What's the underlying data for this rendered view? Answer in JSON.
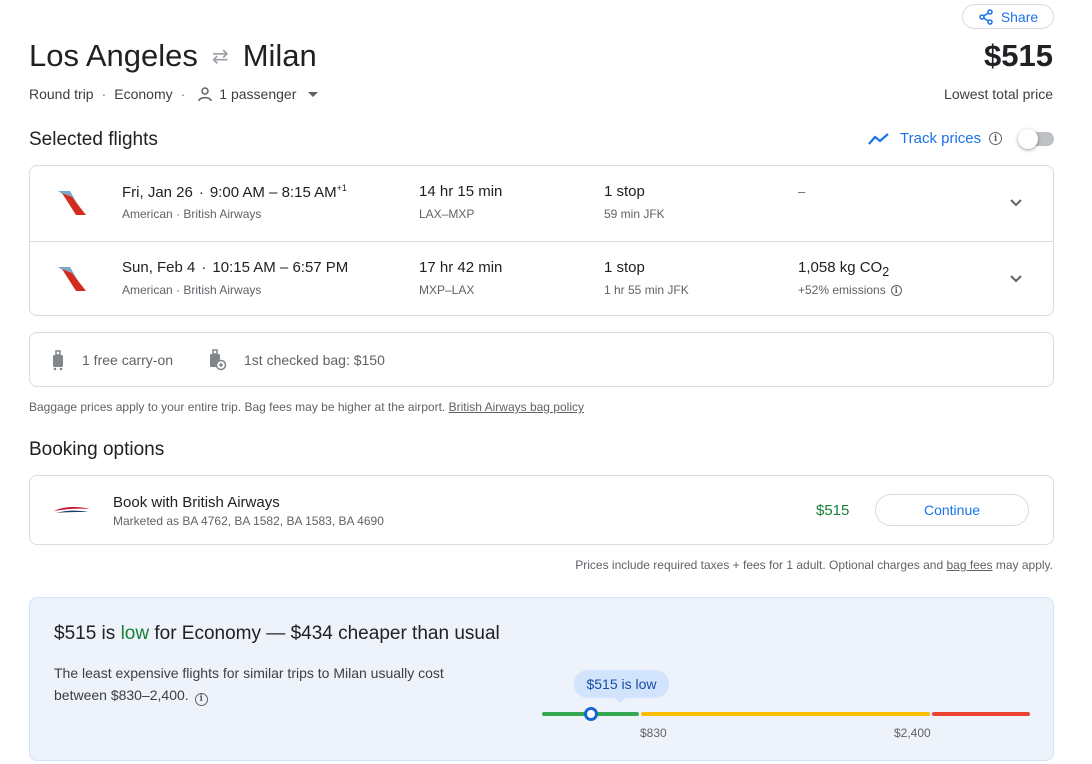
{
  "header": {
    "share_label": "Share",
    "origin": "Los Angeles",
    "destination": "Milan",
    "trip_type": "Round trip",
    "cabin": "Economy",
    "passengers": "1 passenger",
    "price": "$515",
    "price_caption": "Lowest total price"
  },
  "selected_flights": {
    "title": "Selected flights",
    "track_label": "Track prices",
    "flights": [
      {
        "date": "Fri, Jan 26",
        "times": "9:00 AM – 8:15 AM",
        "day_offset": "+1",
        "airlines": "American · British Airways",
        "duration": "14 hr 15 min",
        "route": "LAX–MXP",
        "stops": "1 stop",
        "layover": "59 min JFK",
        "emissions": "–",
        "emissions_note": ""
      },
      {
        "date": "Sun, Feb 4",
        "times": "10:15 AM – 6:57 PM",
        "day_offset": "",
        "airlines": "American · British Airways",
        "duration": "17 hr 42 min",
        "route": "MXP–LAX",
        "stops": "1 stop",
        "layover": "1 hr 55 min JFK",
        "emissions": "1,058 kg CO",
        "emissions_sub": "2",
        "emissions_note": "+52% emissions"
      }
    ]
  },
  "baggage": {
    "carry_on": "1 free carry-on",
    "checked": "1st checked bag: $150",
    "note": "Baggage prices apply to your entire trip. Bag fees may be higher at the airport.",
    "policy_link": "British Airways bag policy"
  },
  "booking": {
    "title": "Booking options",
    "provider": "Book with British Airways",
    "marketed": "Marketed as BA 4762, BA 1582, BA 1583, BA 4690",
    "price": "$515",
    "continue_label": "Continue",
    "note_before": "Prices include required taxes + fees for 1 adult. Optional charges and",
    "note_link": "bag fees",
    "note_after": "may apply."
  },
  "price_insight": {
    "head_price": "$515 is",
    "head_level": "low",
    "head_rest": "for Economy — $434 cheaper than usual",
    "text": "The least expensive flights for similar trips to Milan usually cost between $830–2,400.",
    "pill": "$515 is low",
    "tick_low": "$830",
    "tick_high": "$2,400",
    "colors": {
      "low": "#34a853",
      "typical": "#fbbc04",
      "high": "#ea4335"
    }
  }
}
